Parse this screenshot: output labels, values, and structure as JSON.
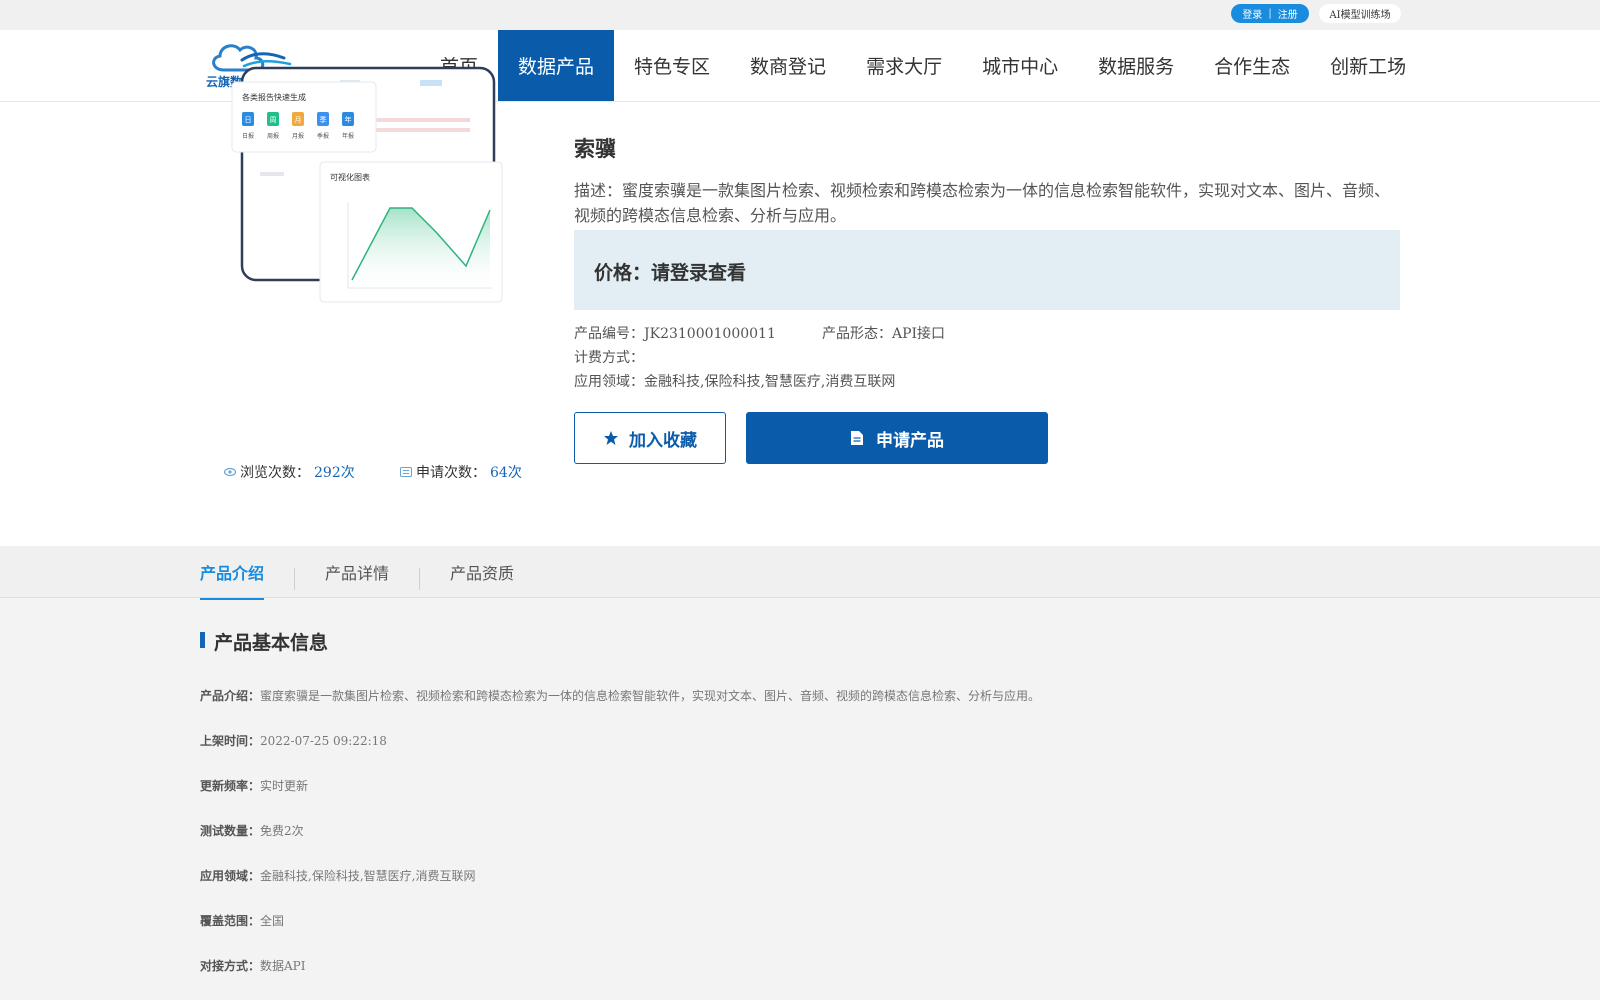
{
  "topbar": {
    "login": "登录",
    "divider": "|",
    "register": "注册",
    "ai_training": "AI模型训练场"
  },
  "brand": {
    "logo_text": "云旗数据交易平台",
    "color": "#1565b5"
  },
  "nav": {
    "items": [
      "首页",
      "数据产品",
      "特色专区",
      "数商登记",
      "需求大厅",
      "城市中心",
      "数据服务",
      "合作生态",
      "创新工场"
    ],
    "active": "数据产品",
    "active_color": "#0a5cab"
  },
  "thumbnail": {
    "card1_title": "各类报告快速生成",
    "card1_badges": [
      "日",
      "周",
      "月",
      "季",
      "年"
    ],
    "card1_labels": [
      "日报",
      "周报",
      "月报",
      "季报",
      "年报"
    ],
    "card2_title": "可视化图表"
  },
  "stats": {
    "views_label": "浏览次数：",
    "views_value": "292次",
    "applies_label": "申请次数：",
    "applies_value": "64次"
  },
  "product": {
    "name": "索骥",
    "description": "描述：蜜度索骥是一款集图片检索、视频检索和跨模态检索为一体的信息检索智能软件，实现对文本、图片、音频、视频的跨模态信息检索、分析与应用。",
    "price": "价格：请登录查看",
    "code_label": "产品编号：",
    "code_value": "JK2310001000011",
    "form_label": "产品形态：",
    "form_value": "API接口",
    "billing_label": "计费方式：",
    "billing_value": "",
    "domain_label": "应用领域：",
    "domain_value": "金融科技,保险科技,智慧医疗,消费互联网"
  },
  "actions": {
    "favorite": "加入收藏",
    "apply": "申请产品"
  },
  "tabs": {
    "items": [
      "产品介绍",
      "产品详情",
      "产品资质"
    ],
    "active": "产品介绍",
    "active_color": "#1a8cde"
  },
  "basic_info": {
    "title": "产品基本信息",
    "rows": [
      {
        "key": "产品介绍：",
        "value": "蜜度索骥是一款集图片检索、视频检索和跨模态检索为一体的信息检索智能软件，实现对文本、图片、音频、视频的跨模态信息检索、分析与应用。"
      },
      {
        "key": "上架时间：",
        "value": "2022-07-25 09:22:18"
      },
      {
        "key": "更新频率：",
        "value": "实时更新"
      },
      {
        "key": "测试数量：",
        "value": "免费2次"
      },
      {
        "key": "应用领域：",
        "value": "金融科技,保险科技,智慧医疗,消费互联网"
      },
      {
        "key": "覆盖范围：",
        "value": "全国"
      },
      {
        "key": "对接方式：",
        "value": "数据API"
      }
    ]
  }
}
